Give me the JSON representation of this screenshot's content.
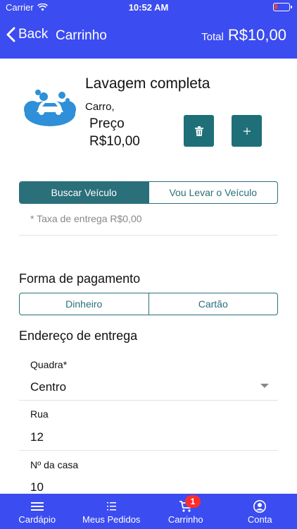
{
  "status": {
    "carrier": "Carrier",
    "time": "10:52 AM",
    "battery_level": 0.2
  },
  "nav": {
    "back_label": "Back",
    "title": "Carrinho",
    "total_label": "Total",
    "total_value": "R$10,00"
  },
  "product": {
    "name": "Lavagem completa",
    "vehicle": "Carro,",
    "price_label": "Preço",
    "price": "R$10,00"
  },
  "delivery": {
    "options": [
      "Buscar Veículo",
      "Vou Levar o Veículo"
    ],
    "selected": 0,
    "fee_text": "* Taxa de entrega R$0,00"
  },
  "payment": {
    "title": "Forma de pagamento",
    "options": [
      "Dinheiro",
      "Cartão"
    ]
  },
  "address": {
    "title": "Endereço de entrega",
    "fields": [
      {
        "label": "Quadra*",
        "value": "Centro"
      },
      {
        "label": "Rua",
        "value": "12"
      },
      {
        "label": "Nº da casa",
        "value": "10"
      }
    ]
  },
  "tabs": [
    {
      "label": "Cardápio",
      "icon": "menu-icon"
    },
    {
      "label": "Meus Pedidos",
      "icon": "list-icon"
    },
    {
      "label": "Carrinho",
      "icon": "cart-icon",
      "badge": "1"
    },
    {
      "label": "Conta",
      "icon": "account-icon"
    }
  ],
  "colors": {
    "primary": "#3b4cf0",
    "teal": "#1e6f78",
    "badge": "#ff2d2d"
  }
}
